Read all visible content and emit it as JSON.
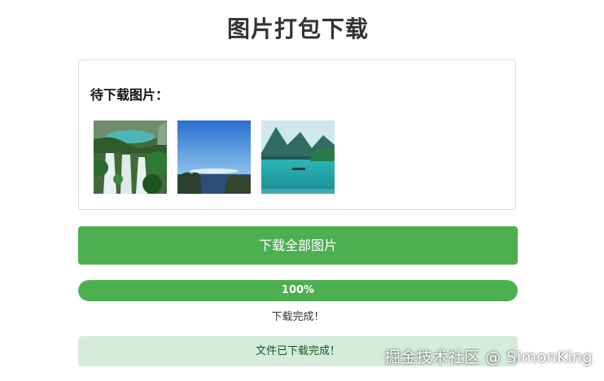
{
  "page": {
    "title": "图片打包下载"
  },
  "card": {
    "title": "待下载图片：",
    "images": [
      {
        "icon": "waterfall-forest-image"
      },
      {
        "icon": "sky-sea-image"
      },
      {
        "icon": "lake-mountain-boat-image"
      }
    ]
  },
  "download_button": {
    "label": "下载全部图片"
  },
  "progress": {
    "value_percent": 100,
    "text": "100%"
  },
  "status": {
    "text": "下载完成！"
  },
  "banner": {
    "text": "文件已下载完成！"
  },
  "watermark": {
    "text": "掘金技术社区 @ SimonKing"
  },
  "colors": {
    "accent": "#4caf50",
    "banner_bg": "#d4edda",
    "banner_text": "#155724"
  }
}
